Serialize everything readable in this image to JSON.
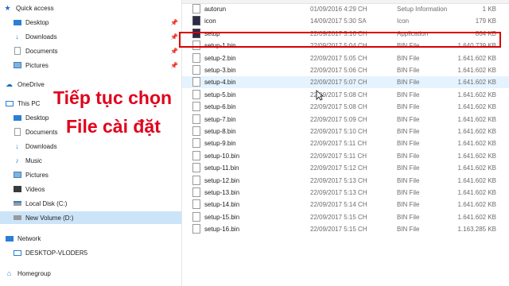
{
  "nav": {
    "quick_access": "Quick access",
    "quick_items": [
      {
        "label": "Desktop",
        "icon": "desktop-icon"
      },
      {
        "label": "Downloads",
        "icon": "downloads-icon"
      },
      {
        "label": "Documents",
        "icon": "documents-icon"
      },
      {
        "label": "Pictures",
        "icon": "pictures-icon"
      }
    ],
    "onedrive": "OneDrive",
    "this_pc": "This PC",
    "pc_items": [
      {
        "label": "Desktop"
      },
      {
        "label": "Documents"
      },
      {
        "label": "Downloads"
      },
      {
        "label": "Music"
      },
      {
        "label": "Pictures"
      },
      {
        "label": "Videos"
      },
      {
        "label": "Local Disk (C:)"
      },
      {
        "label": "New Volume (D:)"
      }
    ],
    "network": "Network",
    "network_item": "DESKTOP-VLODER5",
    "homegroup": "Homegroup"
  },
  "caption": {
    "line1": "Tiếp tục chọn",
    "line2": "File cài đặt"
  },
  "files": [
    {
      "name": "autorun",
      "date": "01/09/2016 4:29 CH",
      "type": "Setup Information",
      "size": "1 KB",
      "icon": "setup-info"
    },
    {
      "name": "icon",
      "date": "14/09/2017 5:30 SA",
      "type": "Icon",
      "size": "179 KB",
      "icon": "app"
    },
    {
      "name": "setup",
      "date": "22/09/2017 5:16 CH",
      "type": "Application",
      "size": "864 KB",
      "icon": "app"
    },
    {
      "name": "setup-1.bin",
      "date": "22/09/2017 5:04 CH",
      "type": "BIN File",
      "size": "1.640.739 KB",
      "icon": "doc"
    },
    {
      "name": "setup-2.bin",
      "date": "22/09/2017 5:05 CH",
      "type": "BIN File",
      "size": "1.641.602 KB",
      "icon": "doc"
    },
    {
      "name": "setup-3.bin",
      "date": "22/09/2017 5:06 CH",
      "type": "BIN File",
      "size": "1.641.602 KB",
      "icon": "doc"
    },
    {
      "name": "setup-4.bin",
      "date": "22/09/2017 5:07 CH",
      "type": "BIN File",
      "size": "1.641.602 KB",
      "icon": "doc"
    },
    {
      "name": "setup-5.bin",
      "date": "22/09/2017 5:08 CH",
      "type": "BIN File",
      "size": "1.641.602 KB",
      "icon": "doc"
    },
    {
      "name": "setup-6.bin",
      "date": "22/09/2017 5:08 CH",
      "type": "BIN File",
      "size": "1.641.602 KB",
      "icon": "doc"
    },
    {
      "name": "setup-7.bin",
      "date": "22/09/2017 5:09 CH",
      "type": "BIN File",
      "size": "1.641.602 KB",
      "icon": "doc"
    },
    {
      "name": "setup-8.bin",
      "date": "22/09/2017 5:10 CH",
      "type": "BIN File",
      "size": "1.641.602 KB",
      "icon": "doc"
    },
    {
      "name": "setup-9.bin",
      "date": "22/09/2017 5:11 CH",
      "type": "BIN File",
      "size": "1.641.602 KB",
      "icon": "doc"
    },
    {
      "name": "setup-10.bin",
      "date": "22/09/2017 5:11 CH",
      "type": "BIN File",
      "size": "1.641.602 KB",
      "icon": "doc"
    },
    {
      "name": "setup-11.bin",
      "date": "22/09/2017 5:12 CH",
      "type": "BIN File",
      "size": "1.641.602 KB",
      "icon": "doc"
    },
    {
      "name": "setup-12.bin",
      "date": "22/09/2017 5:13 CH",
      "type": "BIN File",
      "size": "1.641.602 KB",
      "icon": "doc"
    },
    {
      "name": "setup-13.bin",
      "date": "22/09/2017 5:13 CH",
      "type": "BIN File",
      "size": "1.641.602 KB",
      "icon": "doc"
    },
    {
      "name": "setup-14.bin",
      "date": "22/09/2017 5:14 CH",
      "type": "BIN File",
      "size": "1.641.602 KB",
      "icon": "doc"
    },
    {
      "name": "setup-15.bin",
      "date": "22/09/2017 5:15 CH",
      "type": "BIN File",
      "size": "1.641.602 KB",
      "icon": "doc"
    },
    {
      "name": "setup-16.bin",
      "date": "22/09/2017 5:15 CH",
      "type": "BIN File",
      "size": "1.163.285 KB",
      "icon": "doc"
    }
  ],
  "colors": {
    "highlight_border": "#d90000",
    "caption": "#e0001b",
    "selected_nav": "#cce4f7",
    "hover_row": "#e5f3ff"
  }
}
